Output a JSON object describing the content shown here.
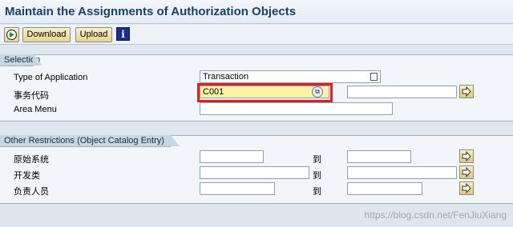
{
  "window": {
    "title": "Maintain the Assignments of Authorization Objects"
  },
  "toolbar": {
    "execute_icon": "execute-icon",
    "download_label": "Download",
    "upload_label": "Upload",
    "info_icon": "info-icon",
    "info_glyph": "i"
  },
  "selection": {
    "title": "Selection",
    "type_of_application": {
      "label": "Type of Application",
      "value": "Transaction"
    },
    "transaction_code": {
      "label": "事务代码",
      "value": "C001",
      "to_value": ""
    },
    "area_menu": {
      "label": "Area Menu",
      "value": ""
    }
  },
  "other_restrictions": {
    "title": "Other Restrictions (Object Catalog Entry)",
    "to_label": "到",
    "rows": [
      {
        "label": "原始系统",
        "from": "",
        "to": ""
      },
      {
        "label": "开发类",
        "from": "",
        "to": ""
      },
      {
        "label": "负责人员",
        "from": "",
        "to": ""
      }
    ]
  },
  "watermark": "https://blog.csdn.net/FenJiuXiang",
  "colors": {
    "highlight_frame": "#e02020",
    "input_active": "#fbf3a5",
    "title": "#17406d"
  }
}
